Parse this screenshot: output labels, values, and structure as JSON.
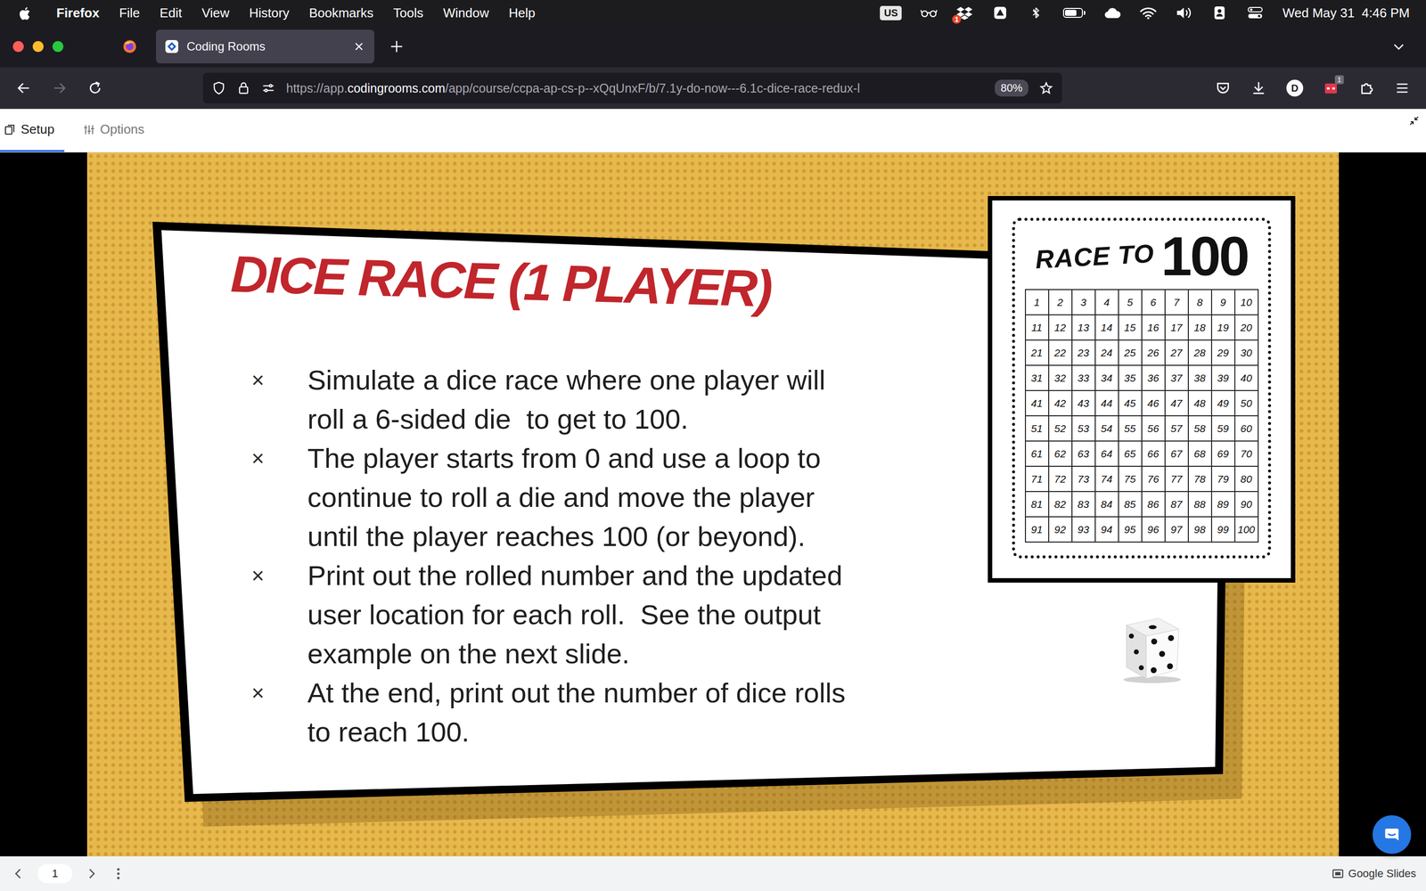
{
  "menu_bar": {
    "app_name": "Firefox",
    "items": [
      "File",
      "Edit",
      "View",
      "History",
      "Bookmarks",
      "Tools",
      "Window",
      "Help"
    ],
    "input_source": "US",
    "dropbox_badge": "1",
    "battery": {
      "level": 0.7
    },
    "clock": "Wed May 31  4:46 PM"
  },
  "browser": {
    "tabs": [
      {
        "label": "Coding Rooms",
        "selected": true
      }
    ],
    "back_enabled": true,
    "forward_enabled": false,
    "url": {
      "scheme": "https://app.",
      "domain": "codingrooms.com",
      "path": "/app/course/ccpa-ap-cs-p--xQqUnxF/b/7.1y-do-now---6.1c-dice-race-redux-l"
    },
    "zoom": "80%",
    "bookmarked": false,
    "avatar": "D",
    "extension_badge": "1"
  },
  "toolbar": {
    "tabs": [
      {
        "label": "Setup",
        "selected": true
      },
      {
        "label": "Options",
        "selected": false
      }
    ]
  },
  "slide": {
    "title": "DICE RACE (1 PLAYER)",
    "bullet_marker": "×",
    "bullets": [
      {
        "lines": [
          "Simulate a dice race where one player will",
          "roll a 6-sided die  to get to 100."
        ]
      },
      {
        "lines": [
          "The player starts from 0 and use a loop to",
          "continue to roll a die and move the player",
          "until the player reaches 100 (or beyond)."
        ]
      },
      {
        "lines": [
          "Print out the rolled number and the updated",
          "user location for each roll.  See the output",
          "example on the next slide."
        ]
      },
      {
        "lines": [
          "At the end, print out the number of dice rolls",
          "to reach 100."
        ]
      }
    ],
    "worksheet": {
      "title": "RACE TO",
      "number": "100",
      "cells": [
        "1",
        "2",
        "3",
        "4",
        "5",
        "6",
        "7",
        "8",
        "9",
        "10",
        "11",
        "12",
        "13",
        "14",
        "15",
        "16",
        "17",
        "18",
        "19",
        "20",
        "21",
        "22",
        "23",
        "24",
        "25",
        "26",
        "27",
        "28",
        "29",
        "30",
        "31",
        "32",
        "33",
        "34",
        "35",
        "36",
        "37",
        "38",
        "39",
        "40",
        "41",
        "42",
        "43",
        "44",
        "45",
        "46",
        "47",
        "48",
        "49",
        "50",
        "51",
        "52",
        "53",
        "54",
        "55",
        "56",
        "57",
        "58",
        "59",
        "60",
        "61",
        "62",
        "63",
        "64",
        "65",
        "66",
        "67",
        "68",
        "69",
        "70",
        "71",
        "72",
        "73",
        "74",
        "75",
        "76",
        "77",
        "78",
        "79",
        "80",
        "81",
        "82",
        "83",
        "84",
        "85",
        "86",
        "87",
        "88",
        "89",
        "90",
        "91",
        "92",
        "93",
        "94",
        "95",
        "96",
        "97",
        "98",
        "99",
        "100"
      ]
    }
  },
  "slides_bar": {
    "page": "1",
    "product": "Google Slides"
  }
}
